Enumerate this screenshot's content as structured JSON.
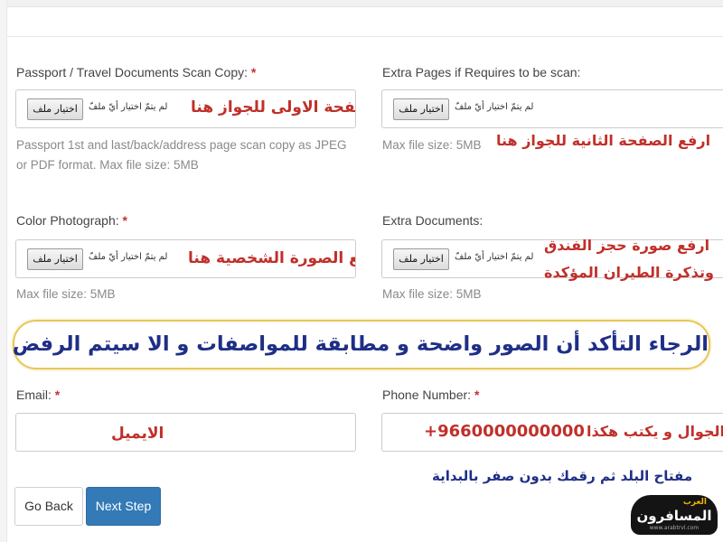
{
  "form": {
    "passport": {
      "label": "Passport / Travel Documents Scan Copy:",
      "required": "*",
      "button": "اختيار ملف",
      "no_file": "لم يتمّ اختيار أيّ ملفّ",
      "help_line1": "Passport 1st and last/back/address page scan copy as JPEG",
      "help_line2": "or PDF format. Max file size: 5MB",
      "note": "ارفع الصفحة الاولى للجواز هنا"
    },
    "extra_pages": {
      "label": "Extra Pages if Requires to be scan:",
      "button": "اختيار ملف",
      "no_file": "لم يتمّ اختيار أيّ ملفّ",
      "help": "Max file size: 5MB",
      "note": "ارفع الصفحة الثانية للجواز هنا"
    },
    "photo": {
      "label": "Color Photograph:",
      "required": "*",
      "button": "اختيار ملف",
      "no_file": "لم يتمّ اختيار أيّ ملفّ",
      "help": "Max file size: 5MB",
      "note": "ارفع الصورة الشخصية هنا"
    },
    "extra_docs": {
      "label": "Extra Documents:",
      "button": "اختيار ملف",
      "no_file": "لم يتمّ اختيار أيّ ملفّ",
      "help": "Max file size: 5MB",
      "note_line1": "ارفع صورة حجز الفندق",
      "note_line2": "وتذكرة الطيران المؤكدة"
    },
    "banner": "الرجاء التأكد أن الصور واضحة و مطابقة للمواصفات و الا سيتم الرفض",
    "email": {
      "label": "Email:",
      "required": "*",
      "note": "الايميل"
    },
    "phone": {
      "label": "Phone Number:",
      "required": "*",
      "example": "+9660000000000",
      "note": "الجوال و يكتب هكذا",
      "hint": "مفتاح البلد ثم رقمك بدون صفر بالبداية"
    },
    "buttons": {
      "back": "Go Back",
      "next": "Next Step"
    }
  },
  "watermark": {
    "top": "العرب",
    "main": "المسافرون",
    "url": "www.arabtrvl.com"
  },
  "colors": {
    "primary": "#337ab7",
    "required": "#c9302c",
    "note_red": "#c0302a",
    "note_blue": "#1f2f86",
    "banner_border": "#e8c75a"
  }
}
